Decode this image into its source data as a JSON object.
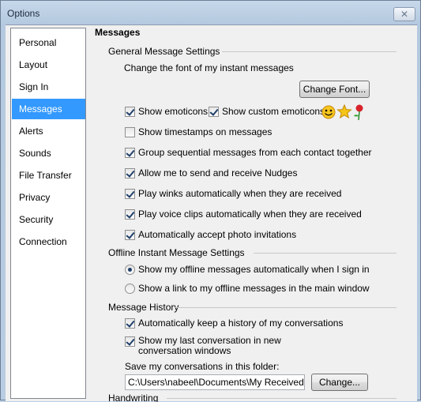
{
  "window": {
    "title": "Options",
    "close_glyph": "✕"
  },
  "sidebar": {
    "items": [
      {
        "label": "Personal"
      },
      {
        "label": "Layout"
      },
      {
        "label": "Sign In"
      },
      {
        "label": "Messages",
        "active": true
      },
      {
        "label": "Alerts"
      },
      {
        "label": "Sounds"
      },
      {
        "label": "File Transfer"
      },
      {
        "label": "Privacy"
      },
      {
        "label": "Security"
      },
      {
        "label": "Connection"
      }
    ]
  },
  "messages": {
    "header": "Messages",
    "general": {
      "title": "General Message Settings",
      "font_text": "Change the font of my instant messages",
      "change_font_button": "Change Font...",
      "show_emoticons": {
        "label": "Show emoticons",
        "checked": true
      },
      "show_custom_emoticons": {
        "label": "Show custom emoticons",
        "checked": true
      },
      "show_timestamps": {
        "label": "Show timestamps on messages",
        "checked": false
      },
      "group_sequential": {
        "label": "Group sequential messages from each contact together",
        "checked": true
      },
      "nudges": {
        "label": "Allow me to send and receive Nudges",
        "checked": true
      },
      "winks": {
        "label": "Play winks automatically when they are received",
        "checked": true
      },
      "voice_clips": {
        "label": "Play voice clips automatically when they are received",
        "checked": true
      },
      "photo_invites": {
        "label": "Automatically accept photo invitations",
        "checked": true
      }
    },
    "offline": {
      "title": "Offline Instant Message Settings",
      "show_auto": {
        "label": "Show my offline messages automatically when I sign in",
        "selected": true
      },
      "show_link": {
        "label": "Show a link to my offline messages in the main window",
        "selected": false
      }
    },
    "history": {
      "title": "Message History",
      "keep_history": {
        "label": "Automatically keep a history of my conversations",
        "checked": true
      },
      "show_last_line1": "Show my last conversation in new",
      "show_last_line2": "conversation windows",
      "show_last_checked": true,
      "folder_label": "Save my conversations in this folder:",
      "folder_path": "C:\\Users\\nabeel\\Documents\\My Received File",
      "change_button": "Change..."
    },
    "handwriting": {
      "title": "Handwriting"
    }
  },
  "icons": [
    "smiley-emoticon-icon",
    "star-emoticon-icon",
    "rose-emoticon-icon"
  ]
}
